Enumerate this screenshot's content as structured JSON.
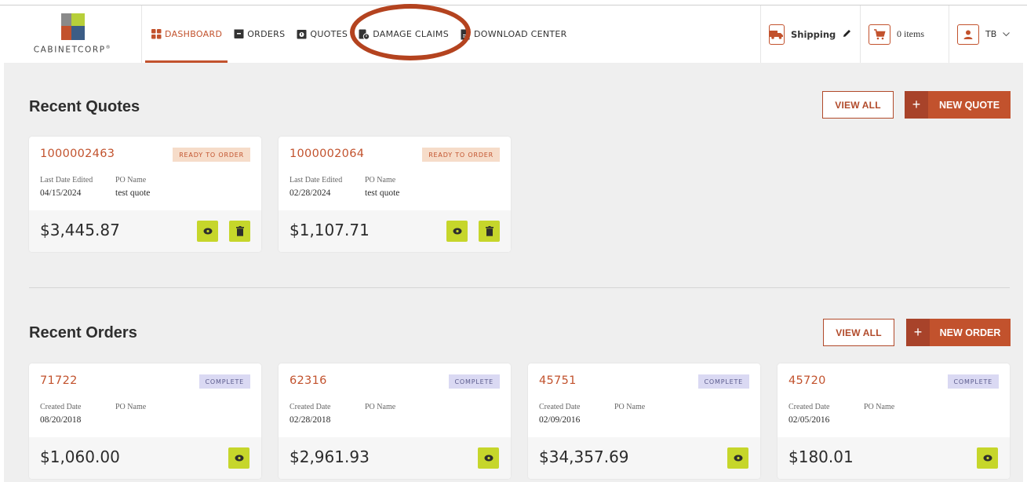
{
  "brand": {
    "name": "CABINETCORP",
    "mark": "®"
  },
  "nav": [
    {
      "label": "DASHBOARD",
      "icon": "grid-icon",
      "active": true
    },
    {
      "label": "ORDERS",
      "icon": "box-icon",
      "active": false
    },
    {
      "label": "QUOTES",
      "icon": "quote-icon",
      "active": false
    },
    {
      "label": "DAMAGE CLAIMS",
      "icon": "damage-claim-icon",
      "active": false
    },
    {
      "label": "DOWNLOAD CENTER",
      "icon": "document-icon",
      "active": false
    }
  ],
  "tools": {
    "shipping_label": "Shipping",
    "cart_label": "0 items",
    "user_initials": "TB"
  },
  "quotes": {
    "title": "Recent Quotes",
    "view_all": "VIEW ALL",
    "new_label": "NEW QUOTE",
    "plus": "+",
    "items": [
      {
        "number": "1000002463",
        "status": "READY TO ORDER",
        "date_label": "Last Date Edited",
        "date": "04/15/2024",
        "po_label": "PO Name",
        "po": "test quote",
        "price": "$3,445.87"
      },
      {
        "number": "1000002064",
        "status": "READY TO ORDER",
        "date_label": "Last Date Edited",
        "date": "02/28/2024",
        "po_label": "PO Name",
        "po": "test quote",
        "price": "$1,107.71"
      }
    ]
  },
  "orders": {
    "title": "Recent Orders",
    "view_all": "VIEW ALL",
    "new_label": "NEW ORDER",
    "plus": "+",
    "items": [
      {
        "number": "71722",
        "status": "COMPLETE",
        "date_label": "Created Date",
        "date": "08/20/2018",
        "po_label": "PO Name",
        "po": "",
        "price": "$1,060.00"
      },
      {
        "number": "62316",
        "status": "COMPLETE",
        "date_label": "Created Date",
        "date": "02/28/2018",
        "po_label": "PO Name",
        "po": "",
        "price": "$2,961.93"
      },
      {
        "number": "45751",
        "status": "COMPLETE",
        "date_label": "Created Date",
        "date": "02/09/2016",
        "po_label": "PO Name",
        "po": "",
        "price": "$34,357.69"
      },
      {
        "number": "45720",
        "status": "COMPLETE",
        "date_label": "Created Date",
        "date": "02/05/2016",
        "po_label": "PO Name",
        "po": "",
        "price": "$180.01"
      }
    ]
  },
  "colors": {
    "accent": "#c2522d",
    "action_green": "#c6d62b",
    "highlight_ring": "#b4431f"
  }
}
